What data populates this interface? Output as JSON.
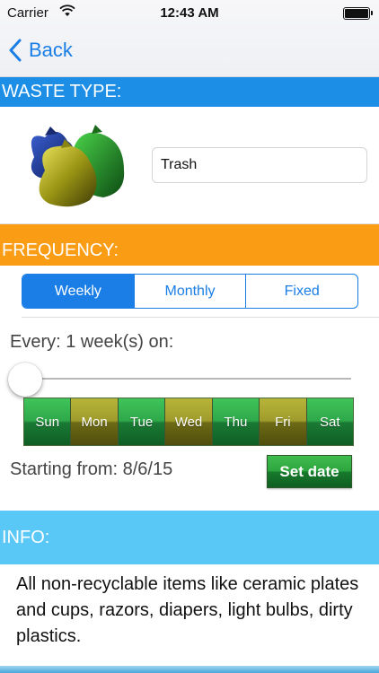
{
  "status": {
    "carrier": "Carrier",
    "time": "12:43 AM"
  },
  "nav": {
    "back_label": "Back"
  },
  "waste": {
    "header": "WASTE TYPE:",
    "value": "Trash"
  },
  "frequency": {
    "header": "FREQUENCY:",
    "tabs": [
      "Weekly",
      "Monthly",
      "Fixed"
    ],
    "selected_tab": "Weekly",
    "every_label": "Every: 1 week(s) on:",
    "slider_value": 0,
    "days": [
      {
        "label": "Sun",
        "style": "green"
      },
      {
        "label": "Mon",
        "style": "olive"
      },
      {
        "label": "Tue",
        "style": "green"
      },
      {
        "label": "Wed",
        "style": "olive"
      },
      {
        "label": "Thu",
        "style": "green"
      },
      {
        "label": "Fri",
        "style": "olive"
      },
      {
        "label": "Sat",
        "style": "green"
      }
    ],
    "starting_label": "Starting from: 8/6/15",
    "set_date_label": "Set date"
  },
  "info": {
    "header": "INFO:",
    "text": "All non-recyclable items like ceramic plates and cups, razors, diapers, light bulbs, dirty plastics."
  },
  "colors": {
    "accent": "#1a7ee6",
    "waste_header": "#1c8ee6",
    "frequency_header": "#fb9c15",
    "info_header": "#5ac8f7",
    "day_green": "#2fa84a",
    "day_olive": "#a09c2c"
  },
  "icons": {
    "wifi": "wifi-icon",
    "battery": "battery-icon",
    "back": "chevron-left-icon",
    "bags": "trash-bags-image"
  }
}
